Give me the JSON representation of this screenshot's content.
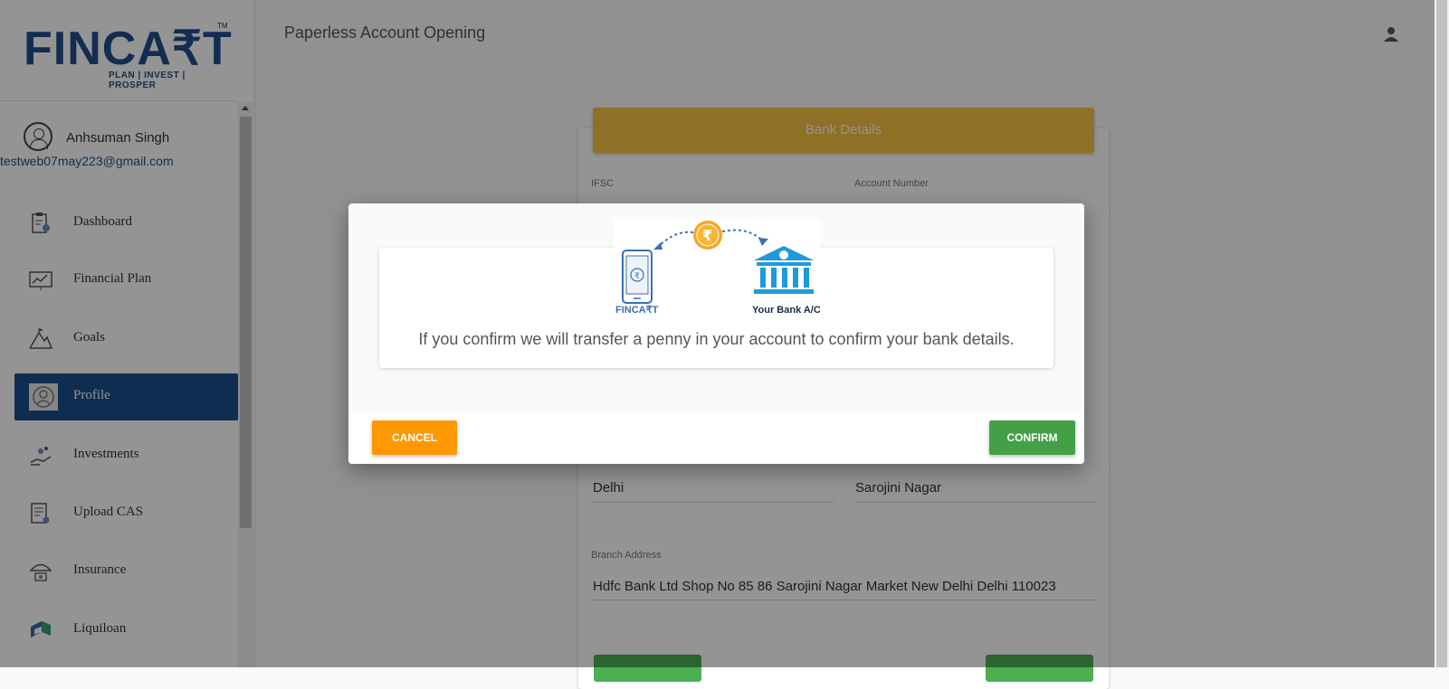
{
  "app": {
    "logo_text": "FINCA₹T",
    "logo_tm": "TM",
    "logo_tagline": "PLAN | INVEST | PROSPER"
  },
  "sidebar": {
    "user_name": "Anhsuman Singh",
    "user_email": "testweb07may223@gmail.com",
    "items": [
      {
        "label": "Dashboard",
        "icon": "dashboard-icon"
      },
      {
        "label": "Financial Plan",
        "icon": "chart-icon"
      },
      {
        "label": "Goals",
        "icon": "mountain-icon"
      },
      {
        "label": "Profile",
        "icon": "user-icon"
      },
      {
        "label": "Investments",
        "icon": "investment-icon"
      },
      {
        "label": "Upload CAS",
        "icon": "document-icon"
      },
      {
        "label": "Insurance",
        "icon": "umbrella-icon"
      },
      {
        "label": "Liquiloan",
        "icon": "liquiloan-icon"
      }
    ],
    "active_index": 3
  },
  "header": {
    "title": "Paperless Account Opening"
  },
  "bank_form": {
    "title": "Bank Details",
    "ifsc_label": "IFSC",
    "account_number_label": "Account Number",
    "city_value": "Delhi",
    "branch_value": "Sarojini Nagar",
    "branch_address_label": "Branch Address",
    "branch_address_value": "Hdfc Bank Ltd Shop No 85 86 Sarojini Nagar Market New Delhi Delhi 110023"
  },
  "modal": {
    "illustration": {
      "rupee_symbol": "₹",
      "left_caption": "FINCA₹T",
      "right_caption": "Your Bank A/C"
    },
    "message": "If you confirm we will transfer a penny in your account to confirm your bank details.",
    "cancel_label": "CANCEL",
    "confirm_label": "CONFIRM"
  },
  "colors": {
    "brand_blue": "#1a4f8b",
    "header_yellow": "#f5c142",
    "cancel_orange": "#ff9800",
    "confirm_green": "#43a047"
  }
}
